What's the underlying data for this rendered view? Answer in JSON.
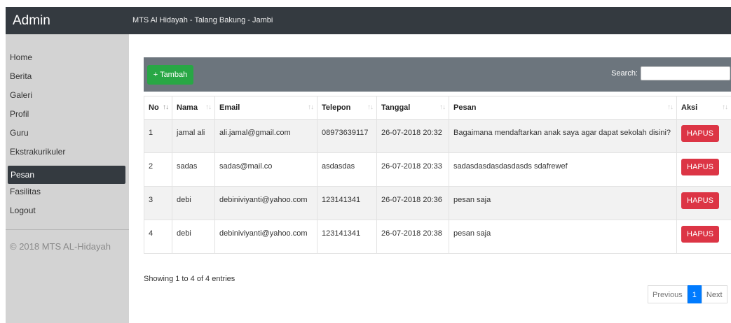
{
  "sidebar": {
    "brand": "Admin",
    "items": [
      {
        "label": "Home"
      },
      {
        "label": "Berita"
      },
      {
        "label": "Galeri"
      },
      {
        "label": "Profil"
      },
      {
        "label": "Guru"
      },
      {
        "label": "Ekstrakurikuler"
      },
      {
        "label": "Pesan"
      },
      {
        "label": "Fasilitas"
      },
      {
        "label": "Logout"
      }
    ],
    "active": "Pesan",
    "footer": "© 2018 MTS AL-Hidayah"
  },
  "topbar": {
    "title": "MTS Al Hidayah - Talang Bakung - Jambi"
  },
  "toolbar": {
    "add_label": "+ Tambah",
    "search_label": "Search:",
    "search_value": ""
  },
  "table": {
    "headers": [
      "No",
      "Nama",
      "Email",
      "Telepon",
      "Tanggal",
      "Pesan",
      "Aksi"
    ],
    "rows": [
      {
        "no": "1",
        "nama": "jamal ali",
        "email": "ali.jamal@gmail.com",
        "telepon": "08973639117",
        "tanggal": "26-07-2018 20:32",
        "pesan": "Bagaimana mendaftarkan anak saya agar dapat sekolah disini?",
        "aksi": "HAPUS"
      },
      {
        "no": "2",
        "nama": "sadas",
        "email": "sadas@mail.co",
        "telepon": "asdasdas",
        "tanggal": "26-07-2018 20:33",
        "pesan": "sadasdasdasdasdasds sdafrewef",
        "aksi": "HAPUS"
      },
      {
        "no": "3",
        "nama": "debi",
        "email": "debiniviyanti@yahoo.com",
        "telepon": "123141341",
        "tanggal": "26-07-2018 20:36",
        "pesan": "pesan saja",
        "aksi": "HAPUS"
      },
      {
        "no": "4",
        "nama": "debi",
        "email": "debiniviyanti@yahoo.com",
        "telepon": "123141341",
        "tanggal": "26-07-2018 20:38",
        "pesan": "pesan saja",
        "aksi": "HAPUS"
      }
    ]
  },
  "info": "Showing 1 to 4 of 4 entries",
  "pagination": {
    "previous": "Previous",
    "current": "1",
    "next": "Next"
  },
  "colors": {
    "dark": "#343a40",
    "sidebar_bg": "#d3d3d3",
    "card_header": "#6c757d",
    "add_green": "#28a745",
    "delete_red": "#dc3545",
    "page_active": "#007bff"
  }
}
